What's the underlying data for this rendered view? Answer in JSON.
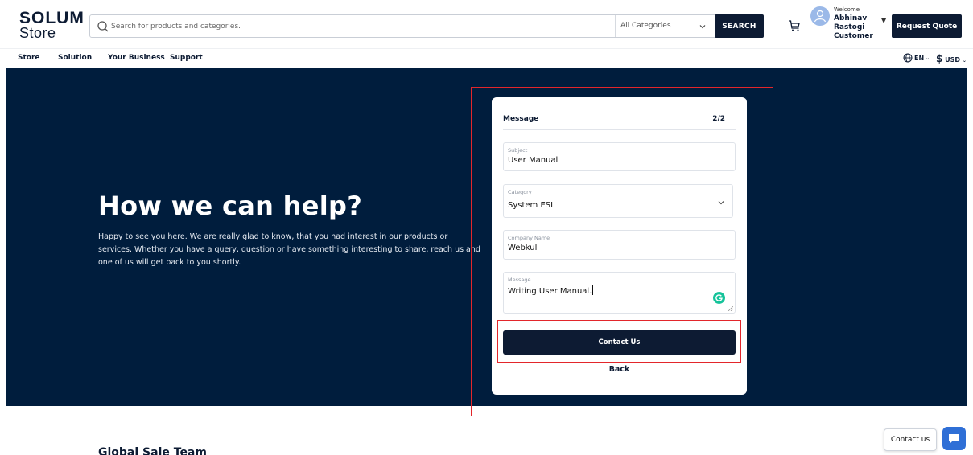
{
  "logo": {
    "top": "SOLUM",
    "bottom": "Store"
  },
  "search": {
    "placeholder": "Search for products and categories.",
    "category": "All Categories",
    "button": "SEARCH"
  },
  "user": {
    "welcome": "Welcome",
    "name_line1": "Abhinav",
    "name_line2": "Rastogi",
    "role": "Customer"
  },
  "header": {
    "quote_button": "Request Quote"
  },
  "nav": {
    "items": [
      "Store",
      "Solution",
      "Your Business",
      "Support"
    ],
    "language": "EN",
    "currency_symbol": "$",
    "currency": "USD"
  },
  "hero": {
    "title": "How we can help?",
    "text": "Happy to see you here. We are really glad to know, that you had interest in our products or services. Whether you have a query, question or have something interesting to share, reach us and one of us will get back to you shortly."
  },
  "form": {
    "title": "Message",
    "step": "2/2",
    "fields": [
      {
        "label": "Subject",
        "value": "User Manual"
      },
      {
        "label": "Category",
        "value": "System ESL"
      },
      {
        "label": "Company Name",
        "value": "Webkul"
      },
      {
        "label": "Message",
        "value": "Writing User Manual."
      }
    ],
    "submit": "Contact Us",
    "back": "Back"
  },
  "section": {
    "title": "Global Sale Team"
  },
  "chat": {
    "label": "Contact us"
  },
  "colors": {
    "navy": "#0d1b33",
    "hero_bg": "#001d3d",
    "highlight": "#e3262b",
    "chat_blue": "#2f6fd6"
  }
}
